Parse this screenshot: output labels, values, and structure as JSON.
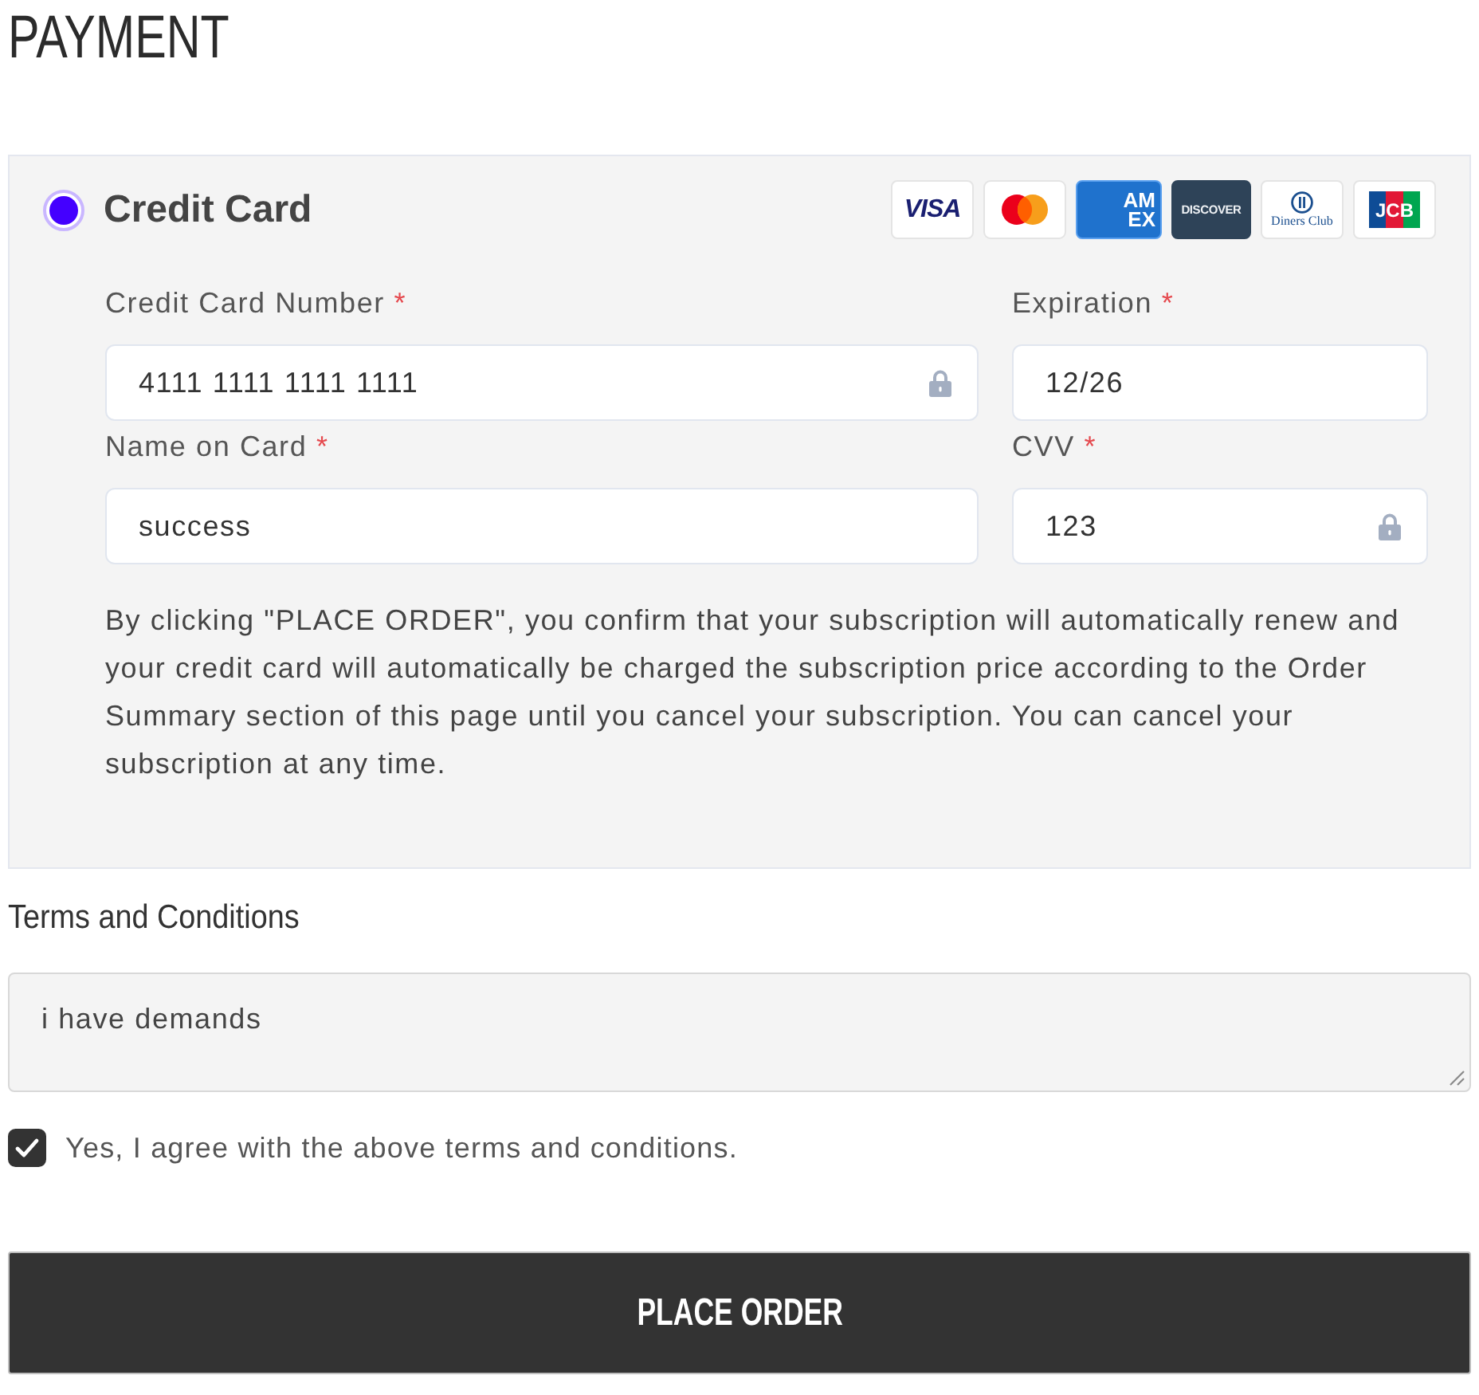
{
  "title": "PAYMENT",
  "payment_method": {
    "label": "Credit Card",
    "selected": true,
    "card_logos": [
      {
        "kind": "visa",
        "text": "VISA"
      },
      {
        "kind": "mastercard"
      },
      {
        "kind": "amex",
        "text": "AM EX"
      },
      {
        "kind": "discover",
        "text": "DISCOVER"
      },
      {
        "kind": "diners",
        "text": "Diners Club"
      },
      {
        "kind": "jcb",
        "text": "JCB"
      }
    ],
    "fields": [
      {
        "label": "Credit Card Number",
        "required_mark": "*",
        "value": "4111 1111 1111 1111",
        "locked": true
      },
      {
        "label": "Expiration",
        "required_mark": "*",
        "value": "12/26",
        "locked": false
      },
      {
        "label": "Name on Card",
        "required_mark": "*",
        "value": "success",
        "locked": false
      },
      {
        "label": "CVV",
        "required_mark": "*",
        "value": "123",
        "locked": true
      }
    ],
    "notice": "By clicking \"PLACE ORDER\", you confirm that your subscription will automatically renew and your credit card will automatically be charged the subscription price according to the Order Summary section of this page until you cancel your subscription. You can cancel your subscription at any time."
  },
  "terms": {
    "label": "Terms and Conditions",
    "value": "i have demands"
  },
  "agreement": {
    "label": "Yes, I agree with the above terms and conditions.",
    "checked": true
  },
  "submit_button": {
    "label": "PLACE ORDER"
  }
}
